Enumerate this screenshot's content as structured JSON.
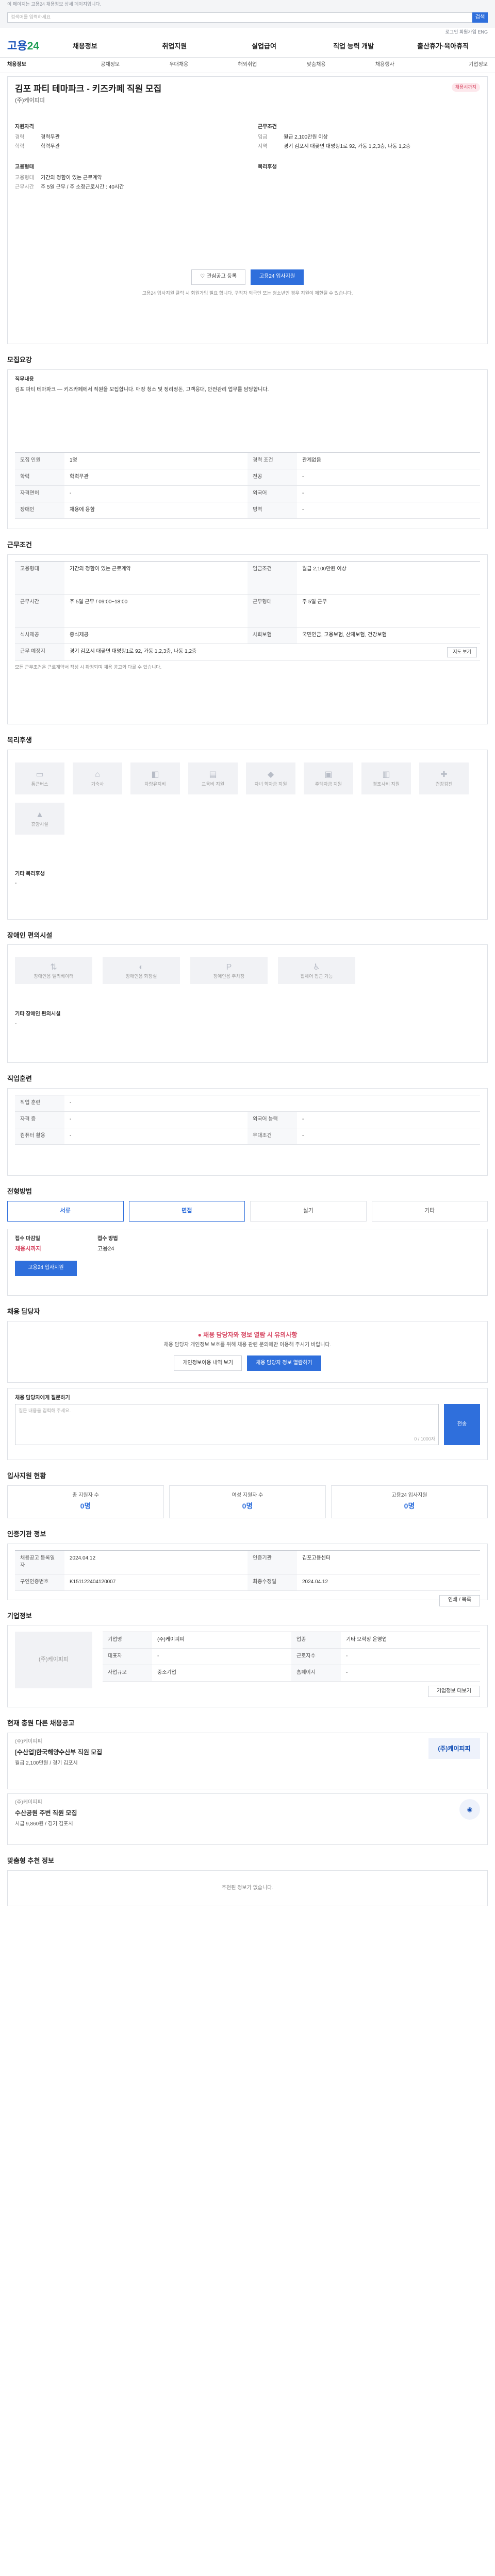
{
  "top": {
    "notice": "이 페이지는 고용24 채용정보 상세 페이지입니다.",
    "search_placeholder": "검색어를 입력하세요",
    "search_btn": "검색",
    "util": "로그인  회원가입  ENG"
  },
  "nav": {
    "logo_a": "고용",
    "logo_b": "24",
    "menus": [
      "채용정보",
      "취업지원",
      "실업급여",
      "직업 능력 개발",
      "출산휴가·육아휴직"
    ],
    "sub": [
      "채용정보",
      "공채정보",
      "우대채용",
      "해외취업",
      "맞춤채용",
      "채용행사",
      "기업정보"
    ]
  },
  "job": {
    "title": "김포 파티 테마파크 - 키즈카페 직원 모집",
    "badge": "채용시까지",
    "corp": "(주)케이피피",
    "left_h": "지원자격",
    "left": [
      [
        "경력",
        "경력무관"
      ],
      [
        "학력",
        "학력무관"
      ]
    ],
    "right_h": "근무조건",
    "right": [
      [
        "임금",
        "월급 2,100만원 이상"
      ],
      [
        "지역",
        "경기 김포시 대곶면 대명항1로 92, 가동 1,2,3층, 나동 1,2층"
      ]
    ],
    "emp_h": "고용형태",
    "emp": [
      [
        "고용형태",
        "기간의 정함이 있는 근로계약"
      ],
      [
        "근무시간",
        "주 5일 근무 / 주 소정근로시간 : 40시간"
      ]
    ],
    "welfare_h": "복리후생",
    "btn_scrap": "관심공고 등록",
    "btn_apply": "고용24 입사지원",
    "note": "고용24 입사지원 클릭 시 회원가입 필요 합니다. 구직자 외국인 또는 청소년인 경우 지원이 제한될 수 있습니다."
  },
  "detail": {
    "h": "모집요강",
    "sub": "직무내용",
    "body": "김포 파티 테마파크 — 키즈카페에서 직원을 모집합니다. 매장 청소 및 정리정돈, 고객응대, 안전관리 업무를 담당합니다.",
    "rows": [
      [
        "모집 인원",
        "1명",
        "경력 조건",
        "관계없음"
      ],
      [
        "학력",
        "학력무관",
        "전공",
        "-"
      ],
      [
        "자격면허",
        "-",
        "외국어",
        "-"
      ],
      [
        "장애인",
        "채용에 응함",
        "병역",
        "-"
      ]
    ]
  },
  "cond": {
    "h": "근무조건",
    "rows": [
      [
        "고용형태",
        "기간의 정함이 있는 근로계약",
        "임금조건",
        "월급 2,100만원 이상"
      ],
      [
        "근무시간",
        "주 5일 근무 / 09:00~18:00",
        "근무형태",
        "주 5일 근무"
      ],
      [
        "식사제공",
        "중식제공",
        "사회보험",
        "국민연금, 고용보험, 산재보험, 건강보험"
      ],
      [
        "근무 예정지",
        "경기 김포시 대곶면 대명항1로 92, 가동 1,2,3층, 나동 1,2층",
        "",
        ""
      ]
    ],
    "map_btn": "지도 보기",
    "note": "모든 근무조건은 근로계약서 작성 시 확정되며 채용 공고와 다를 수 있습니다."
  },
  "welfare": {
    "h": "복리후생",
    "tiles": [
      "통근버스",
      "기숙사",
      "차량유지비",
      "교육비 지원",
      "자녀 학자금 지원",
      "주택자금 지원",
      "경조사비 지원",
      "건강검진",
      "휴양시설"
    ],
    "other_h": "기타 복리후생",
    "other": "-"
  },
  "disab": {
    "h": "장애인 편의시설",
    "tiles": [
      "장애인용 엘리베이터",
      "장애인용 화장실",
      "장애인용 주차장",
      "휠체어 접근 가능"
    ],
    "other_h": "기타 장애인 편의시설",
    "other": "-"
  },
  "exp": {
    "h": "직업훈련",
    "rows": [
      [
        "직업 훈련",
        "-",
        "",
        ""
      ],
      [
        "자격 증",
        "-",
        "외국어 능력",
        "-"
      ],
      [
        "컴퓨터 활용",
        "-",
        "우대조건",
        "-"
      ]
    ]
  },
  "method": {
    "h": "전형방법",
    "tabs": [
      "서류",
      "면접",
      "실기",
      "기타"
    ],
    "recv_h": "접수 마감일",
    "recv": "채용시까지",
    "method_h": "접수 방법",
    "method": "고용24",
    "apply_btn": "고용24 입사지원"
  },
  "contact": {
    "h": "채용 담당자",
    "alert": "채용 담당자와 정보 열람 시 유의사항",
    "alert_desc": "채용 담당자 개인정보 보호를 위해 채용 관련 문의에만 이용해 주시기 바랍니다.",
    "btn1": "개인정보이용 내역 보기",
    "btn2": "채용 담당자 정보 열람하기",
    "q_h": "채용 담당자에게 질문하기",
    "q_btn": "전송",
    "q_count": "0 / 1000자",
    "q_placeholder": "질문 내용을 입력해 주세요."
  },
  "stats": {
    "h": "입사지원 현황",
    "items": [
      [
        "총 지원자 수",
        "0명"
      ],
      [
        "여성 지원자 수",
        "0명"
      ],
      [
        "고용24 입사지원",
        "0명"
      ]
    ]
  },
  "info": {
    "h": "인증기관 정보",
    "rows": [
      [
        "채용공고 등록일자",
        "2024.04.12",
        "인증기관",
        "김포고용센터"
      ],
      [
        "구인인증번호",
        "K151122404120007",
        "최종수정일",
        "2024.04.12"
      ]
    ],
    "btn": "인쇄 / 목록"
  },
  "company": {
    "h": "기업정보",
    "name": "(주)케이피피",
    "rows": [
      [
        "기업명",
        "(주)케이피피",
        "업종",
        "기타 오락장 운영업"
      ],
      [
        "대표자",
        "-",
        "근로자수",
        "-"
      ],
      [
        "사업규모",
        "중소기업",
        "홈페이지",
        "-"
      ]
    ],
    "btn": "기업정보 더보기"
  },
  "others": {
    "h": "현재 충원 다른 채용공고",
    "items": [
      [
        "(주)케이피피",
        "[수산업]한국해양수산부 직원 모집",
        "월급 2,100만원 / 경기 김포시"
      ],
      [
        "(주)케이피피",
        "수산공원 주변 직원 모집",
        "시급 9,860원 / 경기 김포시"
      ]
    ]
  },
  "recommend": {
    "h": "맞춤형 추천 정보",
    "empty": "추천된 정보가 없습니다."
  }
}
